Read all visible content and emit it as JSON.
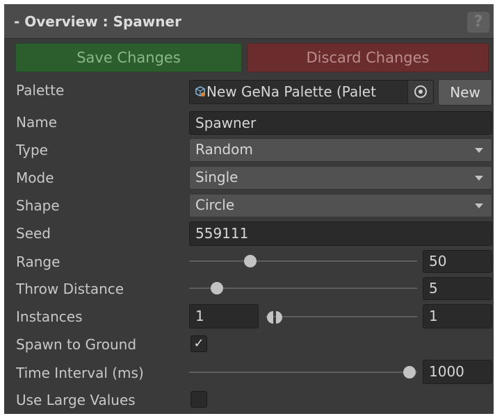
{
  "header": {
    "title": "- Overview : Spawner",
    "help_icon": "?"
  },
  "buttons": {
    "save": "Save Changes",
    "discard": "Discard Changes"
  },
  "colors": {
    "panel_bg": "#3a3a3a",
    "save_bg": "#2c5d2d",
    "discard_bg": "#6a2c2c"
  },
  "fields": {
    "palette": {
      "label": "Palette",
      "value": "New GeNa Palette (Palet",
      "new_label": "New"
    },
    "name": {
      "label": "Name",
      "value": "Spawner"
    },
    "type": {
      "label": "Type",
      "value": "Random"
    },
    "mode": {
      "label": "Mode",
      "value": "Single"
    },
    "shape": {
      "label": "Shape",
      "value": "Circle"
    },
    "seed": {
      "label": "Seed",
      "value": "559111"
    },
    "range": {
      "label": "Range",
      "value": "50"
    },
    "throw_distance": {
      "label": "Throw Distance",
      "value": "5"
    },
    "instances": {
      "label": "Instances",
      "min": "1",
      "max": "1"
    },
    "spawn_to_ground": {
      "label": "Spawn to Ground",
      "checked": true,
      "check_glyph": "✓"
    },
    "time_interval": {
      "label": "Time Interval (ms)",
      "value": "1000"
    },
    "use_large_values": {
      "label": "Use Large Values",
      "checked": false
    }
  }
}
